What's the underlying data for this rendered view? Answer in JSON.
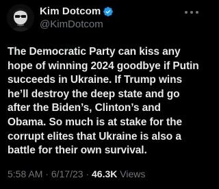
{
  "author": {
    "display_name": "Kim Dotcom",
    "handle": "@KimDotcom",
    "verified": true,
    "verified_color": "#1d9bf0"
  },
  "tweet": {
    "text": "The Democratic Party can kiss any hope of winning 2024 goodbye if Putin succeeds in Ukraine. If Trump wins he’ll destroy the deep state and go after the Biden’s, Clinton’s and Obama. So much is at stake for the corrupt elites that Ukraine is also a battle for their own survival."
  },
  "meta": {
    "time": "5:58 AM",
    "separator": "·",
    "date": "6/17/23",
    "views_count": "46.3K",
    "views_label": "Views"
  },
  "icons": {
    "avatar": "avatar-photo",
    "verified": "verified-badge-icon",
    "more": "more-options-icon"
  },
  "colors": {
    "background": "#000000",
    "primary_text": "#e7e9ea",
    "secondary_text": "#71767b"
  }
}
